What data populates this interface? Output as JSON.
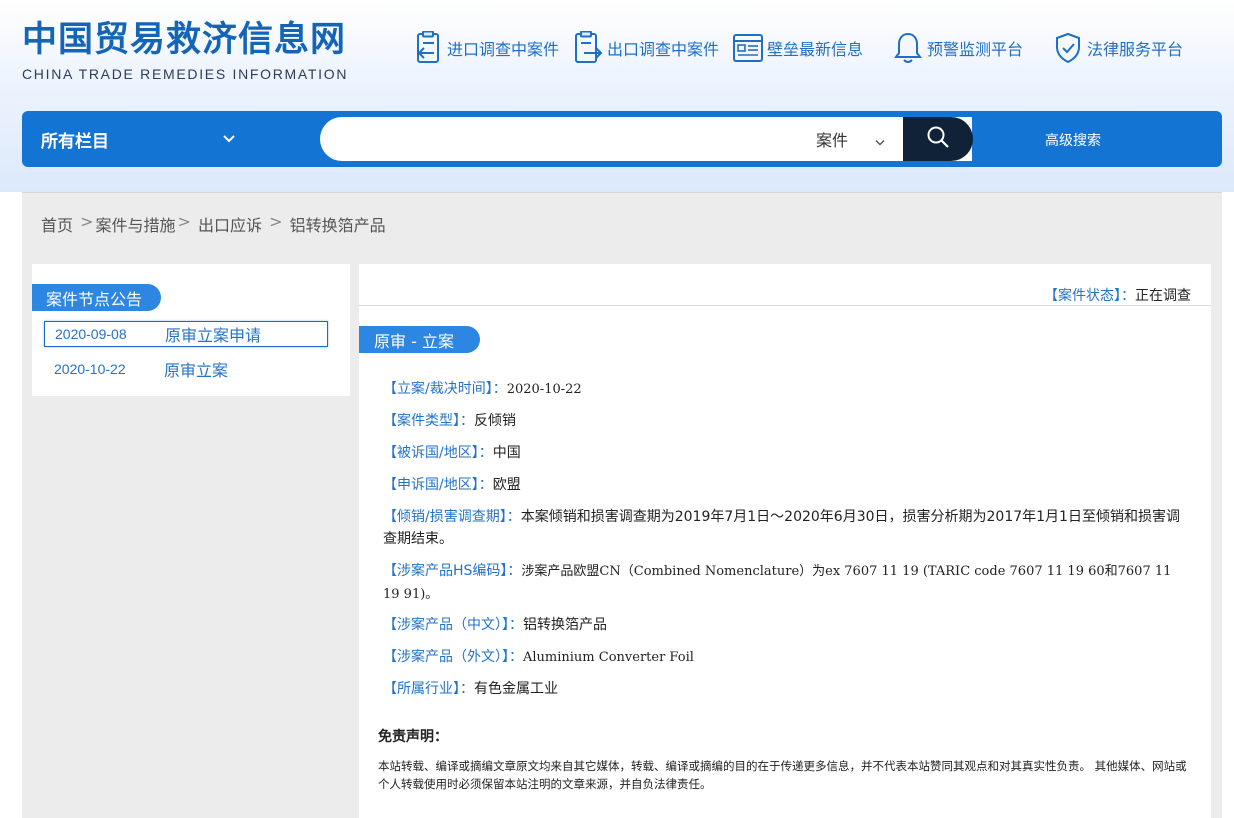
{
  "brand": {
    "name_cn": "中国贸易救济信息网",
    "name_en": "CHINA TRADE REMEDIES INFORMATION"
  },
  "topnav": [
    {
      "label": "进口调查中案件",
      "icon": "import-document-icon"
    },
    {
      "label": "出口调查中案件",
      "icon": "export-document-icon"
    },
    {
      "label": "壁垒最新信息",
      "icon": "news-list-icon"
    },
    {
      "label": "预警监测平台",
      "icon": "bell-icon"
    },
    {
      "label": "法律服务平台",
      "icon": "shield-check-icon"
    }
  ],
  "search": {
    "category": "所有栏目",
    "query": "",
    "type": "案件",
    "advanced_label": "高级搜索"
  },
  "breadcrumb": [
    "首页",
    "案件与措施",
    "出口应诉",
    "铝转换箔产品"
  ],
  "left": {
    "tag": "案件节点公告",
    "notices": [
      {
        "date": "2020-09-08",
        "title": "原审立案申请"
      },
      {
        "date": "2020-10-22",
        "title": "原审立案"
      }
    ]
  },
  "case": {
    "status_key": "【案件状态】：",
    "status_value": "正在调查",
    "phase": "原审 - 立案",
    "fields": [
      {
        "key": "【立案/裁决时间】：",
        "value": "2020-10-22"
      },
      {
        "key": "【案件类型】：",
        "value": "反倾销"
      },
      {
        "key": "【被诉国/地区】：",
        "value": "中国"
      },
      {
        "key": "【申诉国/地区】：",
        "value": "欧盟"
      },
      {
        "key": "【倾销/损害调查期】：",
        "value": "本案倾销和损害调查期为2019年7月1日～2020年6月30日，损害分析期为2017年1月1日至倾销和损害调查期结束。"
      },
      {
        "key": "【涉案产品HS编码】：",
        "value": "涉案产品欧盟CN（Combined Nomenclature）为ex 7607 11 19 (TARIC code 7607 11 19 60和7607 11 19 91)。"
      },
      {
        "key": "【涉案产品（中文）】：",
        "value": "铝转换箔产品"
      },
      {
        "key": "【涉案产品（外文）】：",
        "value": "Aluminium Converter Foil"
      },
      {
        "key": "【所属行业】：",
        "value": "有色金属工业"
      }
    ]
  },
  "disclaimer": {
    "title": "免责声明：",
    "text": "本站转载、编译或摘编文章原文均来自其它媒体，转载、编译或摘编的目的在于传递更多信息，并不代表本站赞同其观点和对其真实性负责。 其他媒体、网站或个人转载使用时必须保留本站注明的文章来源，并自负法律责任。"
  },
  "colors": {
    "brand_blue": "#1565b7",
    "bar_blue": "#1474d4",
    "link_blue": "#2473c9",
    "search_button": "#0f2238"
  }
}
